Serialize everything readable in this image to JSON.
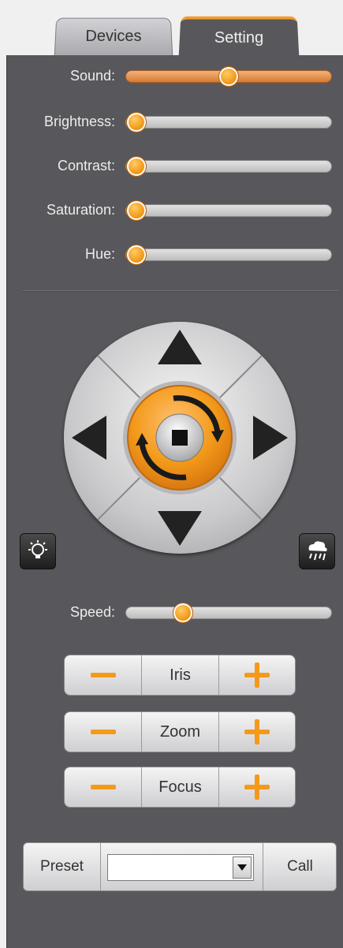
{
  "tabs": [
    {
      "label": "Devices",
      "active": false
    },
    {
      "label": "Setting",
      "active": true
    }
  ],
  "sliders": [
    {
      "id": "sound",
      "label": "Sound:",
      "value": 0.5,
      "filled": true
    },
    {
      "id": "brightness",
      "label": "Brightness:",
      "value": 0.0,
      "filled": false
    },
    {
      "id": "contrast",
      "label": "Contrast:",
      "value": 0.0,
      "filled": false
    },
    {
      "id": "saturation",
      "label": "Saturation:",
      "value": 0.0,
      "filled": false
    },
    {
      "id": "hue",
      "label": "Hue:",
      "value": 0.0,
      "filled": false
    }
  ],
  "ptz": {
    "up": "up-arrow-icon",
    "down": "down-arrow-icon",
    "left": "left-arrow-icon",
    "right": "right-arrow-icon",
    "center": "auto-rotate-icon",
    "stop": "stop-icon"
  },
  "side_icons": {
    "left": "light-bulb-icon",
    "right": "rain-wiper-icon"
  },
  "speed": {
    "label": "Speed:",
    "value": 0.25
  },
  "controls": [
    {
      "id": "iris",
      "label": "Iris"
    },
    {
      "id": "zoom",
      "label": "Zoom"
    },
    {
      "id": "focus",
      "label": "Focus"
    }
  ],
  "preset": {
    "label": "Preset",
    "selected": "",
    "call_label": "Call"
  },
  "colors": {
    "accent": "#f39a1a",
    "panel": "#58585c",
    "text": "#ececec"
  }
}
